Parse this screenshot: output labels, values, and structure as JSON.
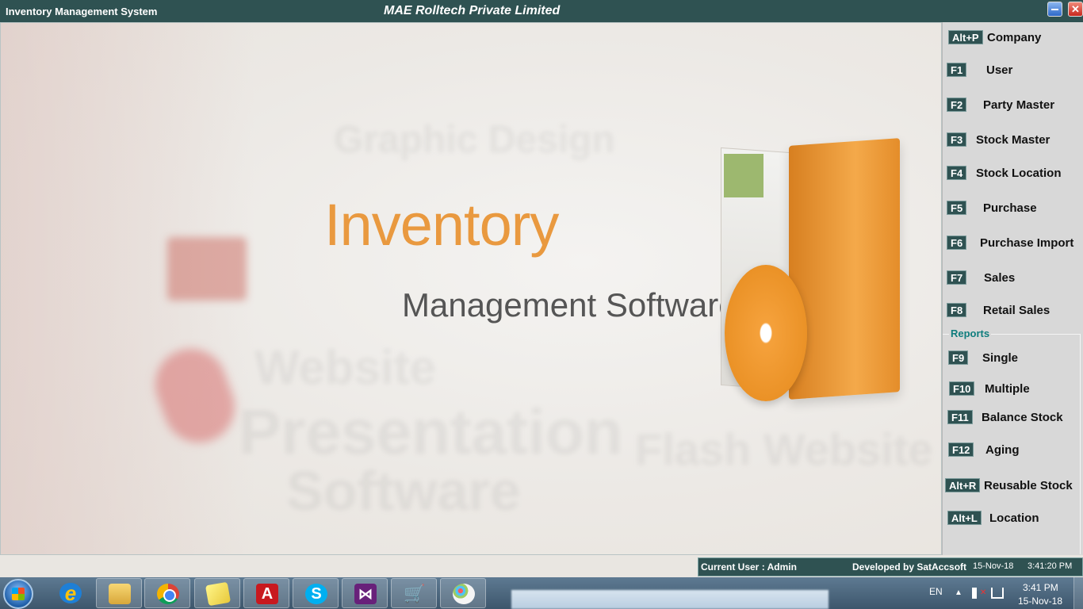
{
  "window": {
    "app_title": "Inventory Management System",
    "company_title": "MAE Rolltech Private Limited",
    "minimize_icon": "minimize-icon",
    "close_icon": "close-icon",
    "close_glyph": "✕"
  },
  "splash": {
    "logo_line1": "Inventory",
    "logo_line2": "Management Software",
    "background_words": [
      "Website",
      "Presentation",
      "Flash Website",
      "Software",
      "Graphic Design"
    ],
    "accent_color": "#e9993f"
  },
  "menu": {
    "items": [
      {
        "key": "Alt+P",
        "label": "Company"
      },
      {
        "key": "F1",
        "label": "User"
      },
      {
        "key": "F2",
        "label": "Party Master"
      },
      {
        "key": "F3",
        "label": "Stock Master"
      },
      {
        "key": "F4",
        "label": "Stock Location"
      },
      {
        "key": "F5",
        "label": "Purchase"
      },
      {
        "key": "F6",
        "label": "Purchase Import"
      },
      {
        "key": "F7",
        "label": "Sales"
      },
      {
        "key": "F8",
        "label": "Retail Sales"
      }
    ],
    "reports_title": "Reports",
    "reports": [
      {
        "key": "F9",
        "label": "Single"
      },
      {
        "key": "F10",
        "label": "Multiple"
      },
      {
        "key": "F11",
        "label": "Balance Stock"
      },
      {
        "key": "F12",
        "label": "Aging"
      },
      {
        "key": "Alt+R",
        "label": "Reusable Stock"
      },
      {
        "key": "Alt+L",
        "label": "Location"
      }
    ],
    "key_bg_color": "#2f5252"
  },
  "status": {
    "current_user": "Current User : Admin",
    "developer": "Developed by SatAccsoft",
    "date": "15-Nov-18",
    "time": "3:41:20 PM"
  },
  "taskbar": {
    "apps": [
      {
        "name": "internet-explorer-icon",
        "glyph": "e"
      },
      {
        "name": "file-explorer-icon",
        "glyph": ""
      },
      {
        "name": "chrome-icon",
        "glyph": ""
      },
      {
        "name": "sticky-notes-icon",
        "glyph": ""
      },
      {
        "name": "acrobat-reader-icon",
        "glyph": "A"
      },
      {
        "name": "skype-icon",
        "glyph": "S"
      },
      {
        "name": "visual-studio-icon",
        "glyph": "⋈"
      },
      {
        "name": "shopping-cart-icon",
        "glyph": "🛒"
      },
      {
        "name": "paint-icon",
        "glyph": ""
      }
    ],
    "language": "EN",
    "clock_time": "3:41 PM",
    "clock_date": "15-Nov-18"
  }
}
